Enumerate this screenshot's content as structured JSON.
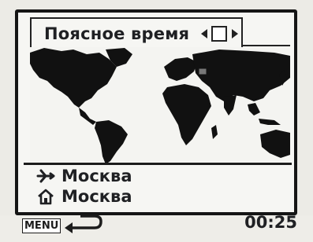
{
  "screen": {
    "title": "Поясное время",
    "destination_city": "Москва",
    "home_city": "Москва",
    "menu_label": "MENU",
    "time": "00:25"
  },
  "icons": {
    "destination": "airplane-icon",
    "home": "house-icon",
    "back": "return-arrow-icon",
    "left": "left-arrow-icon",
    "right": "right-arrow-icon",
    "dst": "dst-checkbox-icon"
  }
}
